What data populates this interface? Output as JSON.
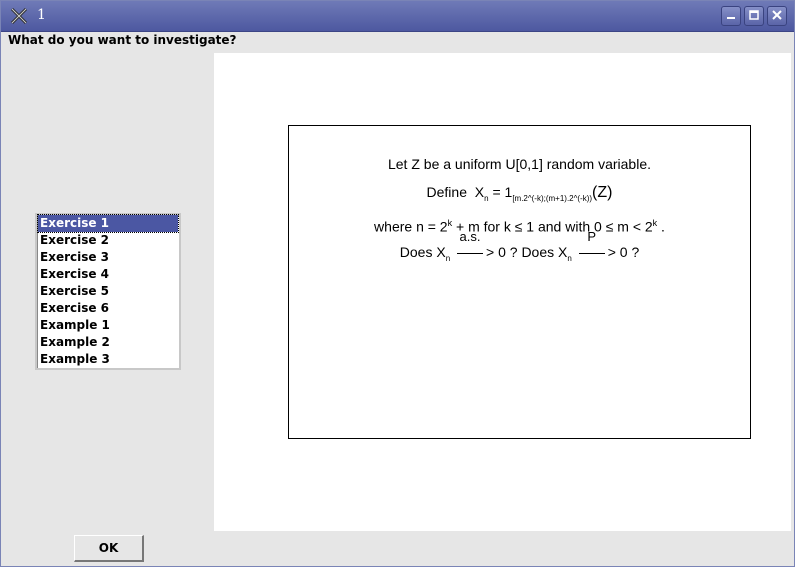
{
  "window": {
    "title": "1",
    "buttons": {
      "minimize": "▁",
      "maximize": "☐",
      "close": "✕"
    }
  },
  "prompt": "What do you want to investigate?",
  "list": {
    "selected_index": 0,
    "items": [
      "Exercise 1",
      "Exercise 2",
      "Exercise 3",
      "Exercise 4",
      "Exercise 5",
      "Exercise 6",
      "Example 1",
      "Example 2",
      "Example 3"
    ]
  },
  "exercise": {
    "line1": "Let Z be a uniform U[0,1] random variable.",
    "define": "Define",
    "x": "X",
    "n": "n",
    "equals_one": " = 1",
    "indicator_sub": "[m.2^(-k);(m+1).2^(-k))",
    "z": "(Z)",
    "where": "where n = 2",
    "k": "k",
    "plus_m": " + m for  k ≤ 1 and with  0 ≤ m  < 2",
    "period": " .",
    "does1": "Does X",
    "as_label": "a.s.",
    "mid": "> 0 ? Does X",
    "p_label": "P",
    "end": "> 0 ?"
  },
  "ok_button": "OK",
  "colors": {
    "titlebar": "#5a64a8",
    "selection": "#4b57a3",
    "background": "#e6e6e6"
  }
}
